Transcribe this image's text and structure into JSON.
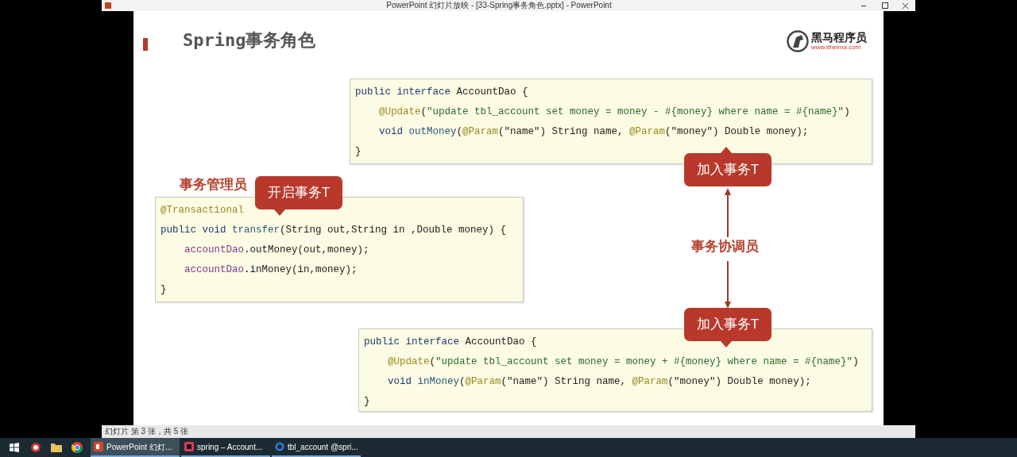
{
  "window": {
    "title": "PowerPoint 幻灯片放映 - [33-Spring事务角色.pptx] - PowerPoint"
  },
  "slide": {
    "title": "Spring事务角色",
    "logo": {
      "name": "黑马程序员",
      "url": "www.itheima.com"
    },
    "code_blocks": [
      {
        "lines": [
          {
            "indented": false,
            "tokens": [
              {
                "kind": "keyword",
                "text": "public interface "
              },
              {
                "kind": "plain",
                "text": "AccountDao {"
              }
            ]
          },
          {
            "indented": true,
            "tokens": [
              {
                "kind": "annotation",
                "text": "@Update"
              },
              {
                "kind": "plain",
                "text": "("
              },
              {
                "kind": "string",
                "text": "\"update tbl_account set money = money - #{money} where name = #{name}\""
              },
              {
                "kind": "plain",
                "text": ")"
              }
            ]
          },
          {
            "indented": true,
            "tokens": [
              {
                "kind": "keyword",
                "text": "void "
              },
              {
                "kind": "method",
                "text": "outMoney"
              },
              {
                "kind": "plain",
                "text": "("
              },
              {
                "kind": "annotation",
                "text": "@Param"
              },
              {
                "kind": "plain",
                "text": "(\"name\") String name, "
              },
              {
                "kind": "annotation",
                "text": "@Param"
              },
              {
                "kind": "plain",
                "text": "(\"money\") Double money);"
              }
            ]
          },
          {
            "indented": false,
            "tokens": [
              {
                "kind": "plain",
                "text": "}"
              }
            ]
          }
        ]
      },
      {
        "lines": [
          {
            "indented": false,
            "tokens": [
              {
                "kind": "annotation",
                "text": "@Transactional"
              }
            ]
          },
          {
            "indented": false,
            "tokens": [
              {
                "kind": "keyword",
                "text": "public void "
              },
              {
                "kind": "method",
                "text": "transfer"
              },
              {
                "kind": "plain",
                "text": "(String out,String in ,Double money) {"
              }
            ]
          },
          {
            "indented": true,
            "tokens": [
              {
                "kind": "field",
                "text": "accountDao"
              },
              {
                "kind": "plain",
                "text": ".outMoney(out,money);"
              }
            ]
          },
          {
            "indented": true,
            "tokens": [
              {
                "kind": "field",
                "text": "accountDao"
              },
              {
                "kind": "plain",
                "text": ".inMoney(in,money);"
              }
            ]
          },
          {
            "indented": false,
            "tokens": [
              {
                "kind": "plain",
                "text": "}"
              }
            ]
          }
        ]
      },
      {
        "lines": [
          {
            "indented": false,
            "tokens": [
              {
                "kind": "keyword",
                "text": "public interface "
              },
              {
                "kind": "plain",
                "text": "AccountDao {"
              }
            ]
          },
          {
            "indented": true,
            "tokens": [
              {
                "kind": "annotation",
                "text": "@Update"
              },
              {
                "kind": "plain",
                "text": "("
              },
              {
                "kind": "string",
                "text": "\"update tbl_account set money = money + #{money} where name = #{name}\""
              },
              {
                "kind": "plain",
                "text": ")"
              }
            ]
          },
          {
            "indented": true,
            "tokens": [
              {
                "kind": "keyword",
                "text": "void "
              },
              {
                "kind": "method",
                "text": "inMoney"
              },
              {
                "kind": "plain",
                "text": "("
              },
              {
                "kind": "annotation",
                "text": "@Param"
              },
              {
                "kind": "plain",
                "text": "(\"name\") String name, "
              },
              {
                "kind": "annotation",
                "text": "@Param"
              },
              {
                "kind": "plain",
                "text": "(\"money\") Double money);"
              }
            ]
          },
          {
            "indented": false,
            "tokens": [
              {
                "kind": "plain",
                "text": "}"
              }
            ]
          }
        ]
      }
    ],
    "labels": [
      "事务管理员",
      "事务协调员"
    ],
    "callouts": [
      {
        "text": "开启事务T",
        "kind": "pointing-down"
      },
      {
        "text": "加入事务T",
        "kind": "pointing-up"
      },
      {
        "text": "加入事务T",
        "kind": "pointing-down"
      }
    ]
  },
  "status_bar": {
    "text": "幻灯片 第 3 张，共 5 张"
  },
  "taskbar": {
    "apps": [
      {
        "label": "PowerPoint 幻灯...",
        "kind": "powerpoint",
        "selected": true
      },
      {
        "label": "spring – Account...",
        "kind": "ide",
        "selected": false
      },
      {
        "label": "tbl_account @spri...",
        "kind": "database",
        "selected": false
      }
    ]
  }
}
